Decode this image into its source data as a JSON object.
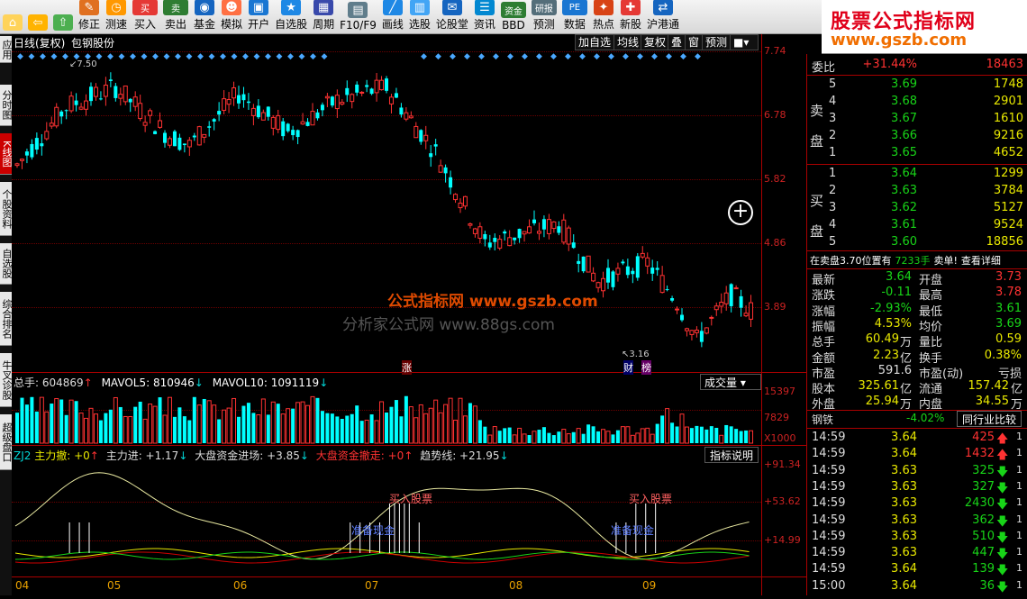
{
  "toolbar": [
    {
      "label": "",
      "icon": "home-icon"
    },
    {
      "label": "",
      "icon": "back-arrow-icon"
    },
    {
      "label": "",
      "icon": "forward-arrow-icon"
    },
    {
      "label": "修正",
      "icon": "pencil-icon"
    },
    {
      "label": "测速",
      "icon": "clock-icon"
    },
    {
      "label": "买入",
      "icon": "buy-icon",
      "icontext": "买"
    },
    {
      "label": "卖出",
      "icon": "sell-icon",
      "icontext": "卖"
    },
    {
      "label": "基金",
      "icon": "fund-icon"
    },
    {
      "label": "模拟",
      "icon": "person-icon"
    },
    {
      "label": "开户",
      "icon": "account-icon"
    },
    {
      "label": "自选股",
      "icon": "star-icon"
    },
    {
      "label": "周期",
      "icon": "calendar-icon"
    },
    {
      "label": "F10/F9",
      "icon": "doc-icon"
    },
    {
      "label": "画线",
      "icon": "draw-line-icon"
    },
    {
      "label": "选股",
      "icon": "chart-icon"
    },
    {
      "label": "论股堂",
      "icon": "forum-icon"
    },
    {
      "label": "资讯",
      "icon": "news-icon"
    },
    {
      "label": "BBD",
      "icon": "money-icon",
      "icontext": "资金"
    },
    {
      "label": "预测",
      "icon": "research-icon",
      "icontext": "研报"
    },
    {
      "label": "数据",
      "icon": "pe-icon",
      "icontext": "PE"
    },
    {
      "label": "热点",
      "icon": "hot-icon"
    },
    {
      "label": "新股",
      "icon": "new-stock-icon"
    },
    {
      "label": "沪港通",
      "icon": "hk-icon"
    }
  ],
  "brand": {
    "title": "股票公式指标网",
    "url": "www.gszb.com"
  },
  "left_tabs": [
    "应用",
    "分时图",
    "K线图",
    "个股资料",
    "自选股",
    "综合排名",
    "牛叉诊股",
    "超级盘口"
  ],
  "chart_header": {
    "period": "日线(复权)",
    "name": "包钢股份"
  },
  "chart_buttons": [
    "加自选",
    "均线",
    "复权",
    "叠",
    "窗",
    "预测"
  ],
  "watermarks": [
    "公式指标网 www.gszb.com",
    "分析家公式网 www.88gs.com"
  ],
  "price_axis": [
    "7.74",
    "6.78",
    "5.82",
    "4.86",
    "3.89"
  ],
  "marks": {
    "high": "7.50",
    "low": "3.16",
    "zhang": "涨",
    "cai": "财",
    "bang": "榜"
  },
  "volume": {
    "label": "总手: 604869",
    "ma5": "MAVOL5: 810946",
    "ma10": "MAVOL10: 1091119",
    "title": "成交量",
    "axis": [
      "15397",
      "7829",
      "X1000"
    ]
  },
  "indicator": {
    "name": "ZJ2",
    "fields": [
      "主力撤: +0",
      "主力进: +1.17",
      "大盘资金进场: +3.85",
      "大盘资金撤走: +0",
      "趋势线: +21.95"
    ],
    "button": "指标说明",
    "axis": [
      "+91.34",
      "+53.62",
      "+14.99"
    ],
    "notes": [
      "买入股票",
      "准备现金",
      "买入股票",
      "准备现金"
    ]
  },
  "x_axis": [
    "04",
    "05",
    "06",
    "07",
    "08",
    "09"
  ],
  "quote": {
    "weibi_label": "委比",
    "weibi": "+31.44%",
    "weicha": "18463",
    "sell_label": "卖盘",
    "buy_label": "买盘",
    "sells": [
      {
        "n": "5",
        "p": "3.69",
        "v": "1748"
      },
      {
        "n": "4",
        "p": "3.68",
        "v": "2901"
      },
      {
        "n": "3",
        "p": "3.67",
        "v": "1610"
      },
      {
        "n": "2",
        "p": "3.66",
        "v": "9216"
      },
      {
        "n": "1",
        "p": "3.65",
        "v": "4652"
      }
    ],
    "buys": [
      {
        "n": "1",
        "p": "3.64",
        "v": "1299"
      },
      {
        "n": "2",
        "p": "3.63",
        "v": "3784"
      },
      {
        "n": "3",
        "p": "3.62",
        "v": "5127"
      },
      {
        "n": "4",
        "p": "3.61",
        "v": "9524"
      },
      {
        "n": "5",
        "p": "3.60",
        "v": "18856"
      }
    ],
    "notice": "在卖盘3.70位置有",
    "notice2": "7233手",
    "notice3": "卖单!",
    "detail": "查看详细",
    "stats": [
      {
        "l1": "最新",
        "v1": "3.64",
        "l2": "开盘",
        "v2": "3.73"
      },
      {
        "l1": "涨跌",
        "v1": "-0.11",
        "l2": "最高",
        "v2": "3.78"
      },
      {
        "l1": "涨幅",
        "v1": "-2.93%",
        "l2": "最低",
        "v2": "3.61"
      },
      {
        "l1": "振幅",
        "v1": "4.53%",
        "l2": "均价",
        "v2": "3.69"
      },
      {
        "l1": "总手",
        "v1": "60.49",
        "u1": "万",
        "l2": "量比",
        "v2": "0.59"
      },
      {
        "l1": "金额",
        "v1": "2.23",
        "u1": "亿",
        "l2": "换手",
        "v2": "0.38%"
      },
      {
        "l1": "市盈",
        "v1": "591.6",
        "l2": "市盈(动)",
        "v2": "亏损"
      },
      {
        "l1": "股本",
        "v1": "325.61",
        "u1": "亿",
        "l2": "流通",
        "v2": "157.42",
        "u2": "亿"
      },
      {
        "l1": "外盘",
        "v1": "25.94",
        "u1": "万",
        "l2": "内盘",
        "v2": "34.55",
        "u2": "万"
      }
    ],
    "industry": "钢铁",
    "industry_chg": "-4.02%",
    "compare": "同行业比较",
    "ticks": [
      {
        "t": "14:59",
        "p": "3.64",
        "v": "425",
        "d": "up"
      },
      {
        "t": "14:59",
        "p": "3.64",
        "v": "1432",
        "d": "up"
      },
      {
        "t": "14:59",
        "p": "3.63",
        "v": "325",
        "d": "dn"
      },
      {
        "t": "14:59",
        "p": "3.63",
        "v": "327",
        "d": "dn"
      },
      {
        "t": "14:59",
        "p": "3.63",
        "v": "2430",
        "d": "dn"
      },
      {
        "t": "14:59",
        "p": "3.63",
        "v": "362",
        "d": "dn"
      },
      {
        "t": "14:59",
        "p": "3.63",
        "v": "510",
        "d": "dn"
      },
      {
        "t": "14:59",
        "p": "3.63",
        "v": "447",
        "d": "dn"
      },
      {
        "t": "14:59",
        "p": "3.64",
        "v": "139",
        "d": "dn"
      },
      {
        "t": "15:00",
        "p": "3.64",
        "v": "36",
        "d": "dn"
      }
    ],
    "tick_flag": "1"
  },
  "colors": {
    "up": "#ff3232",
    "down": "#00ffff",
    "ma1": "#ffffff",
    "ma2": "#e8e800"
  }
}
